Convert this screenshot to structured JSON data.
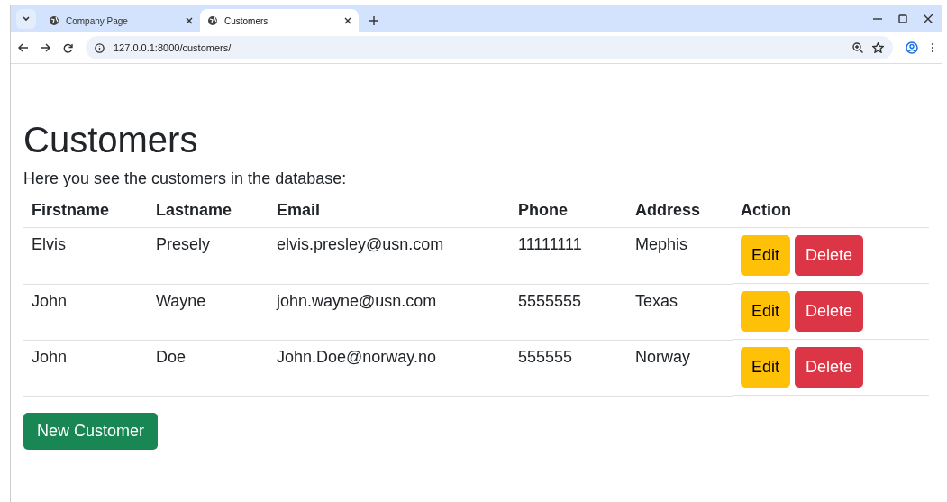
{
  "browser": {
    "tabs": [
      {
        "title": "Company Page",
        "selected": false
      },
      {
        "title": "Customers",
        "selected": true
      }
    ],
    "address": "127.0.0.1:8000/customers/"
  },
  "page": {
    "heading": "Customers",
    "intro": "Here you see the customers in the database:",
    "table": {
      "columns": [
        "Firstname",
        "Lastname",
        "Email",
        "Phone",
        "Address",
        "Action"
      ],
      "rows": [
        {
          "cells": [
            "Elvis",
            "Presely",
            "elvis.presley@usn.com",
            "11111111",
            "Mephis"
          ],
          "actions": [
            {
              "label": "Edit",
              "kind": "edit"
            },
            {
              "label": "Delete",
              "kind": "delete"
            }
          ]
        },
        {
          "cells": [
            "John",
            "Wayne",
            "john.wayne@usn.com",
            "5555555",
            "Texas"
          ],
          "actions": [
            {
              "label": "Edit",
              "kind": "edit"
            },
            {
              "label": "Delete",
              "kind": "delete"
            }
          ]
        },
        {
          "cells": [
            "John",
            "Doe",
            "John.Doe@norway.no",
            "555555",
            "Norway"
          ],
          "actions": [
            {
              "label": "Edit",
              "kind": "edit"
            },
            {
              "label": "Delete",
              "kind": "delete"
            }
          ]
        }
      ]
    },
    "new_button": "New Customer"
  }
}
